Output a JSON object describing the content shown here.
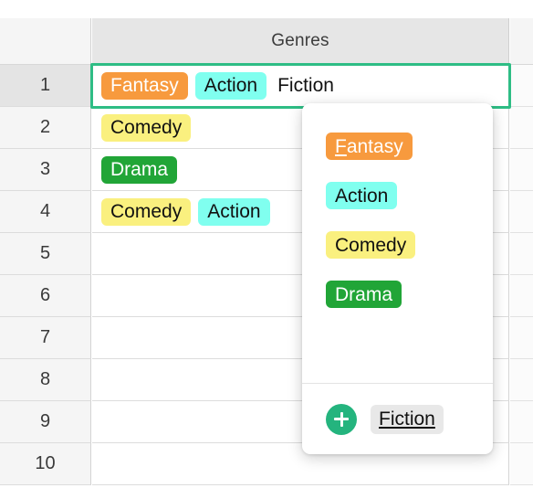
{
  "colors": {
    "selection_border": "#2ebd85",
    "add_button": "#24b47e",
    "fantasy": "#f79a3e",
    "action": "#80ffef",
    "comedy": "#faf07f",
    "drama": "#21a537",
    "header_bg": "#e6e6e6",
    "rowhead_bg": "#f5f5f5"
  },
  "sheet": {
    "column_header": "Genres",
    "row_numbers": [
      "1",
      "2",
      "3",
      "4",
      "5",
      "6",
      "7",
      "8",
      "9",
      "10"
    ],
    "rows": [
      {
        "number": "1",
        "selected": true,
        "tags": [
          {
            "label": "Fantasy",
            "bg": "#f79a3e",
            "color": "#ffffff",
            "underline_first": false
          },
          {
            "label": "Action",
            "bg": "#80ffef",
            "color": "#111111",
            "underline_first": false
          },
          {
            "label": "Fiction",
            "bg": "transparent",
            "color": "#111111",
            "plain": true
          }
        ]
      },
      {
        "number": "2",
        "selected": false,
        "tags": [
          {
            "label": "Comedy",
            "bg": "#faf07f",
            "color": "#111111"
          }
        ]
      },
      {
        "number": "3",
        "selected": false,
        "tags": [
          {
            "label": "Drama",
            "bg": "#21a537",
            "color": "#ffffff"
          }
        ]
      },
      {
        "number": "4",
        "selected": false,
        "tags": [
          {
            "label": "Comedy",
            "bg": "#faf07f",
            "color": "#111111"
          },
          {
            "label": "Action",
            "bg": "#80ffef",
            "color": "#111111"
          }
        ]
      },
      {
        "number": "5",
        "selected": false,
        "tags": []
      },
      {
        "number": "6",
        "selected": false,
        "tags": []
      },
      {
        "number": "7",
        "selected": false,
        "tags": []
      },
      {
        "number": "8",
        "selected": false,
        "tags": []
      },
      {
        "number": "9",
        "selected": false,
        "tags": []
      },
      {
        "number": "10",
        "selected": false,
        "tags": []
      }
    ]
  },
  "dropdown": {
    "options": [
      {
        "label": "Fantasy",
        "bg": "#f79a3e",
        "color": "#ffffff",
        "accel": "F"
      },
      {
        "label": "Action",
        "bg": "#80ffef",
        "color": "#111111",
        "accel": ""
      },
      {
        "label": "Comedy",
        "bg": "#faf07f",
        "color": "#111111",
        "accel": ""
      },
      {
        "label": "Drama",
        "bg": "#21a537",
        "color": "#ffffff",
        "accel": ""
      }
    ],
    "footer": {
      "add_icon": "plus-icon",
      "new_option_label": "Fiction"
    }
  }
}
